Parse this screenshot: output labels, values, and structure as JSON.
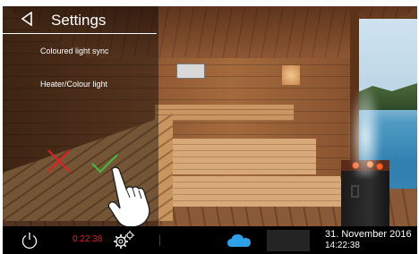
{
  "header": {
    "title": "Settings"
  },
  "menu": {
    "items": [
      {
        "label": "Coloured light sync"
      },
      {
        "label": "Heater/Colour light"
      }
    ]
  },
  "actions": {
    "cancel_icon": "x-icon",
    "confirm_icon": "check-icon"
  },
  "status_bar": {
    "timer": "0:22:38",
    "date": "31. November 2016",
    "time": "14:22:38",
    "icons": [
      "power-icon",
      "gear-icon",
      "cloud-icon"
    ]
  },
  "colors": {
    "accent_red": "#e02020",
    "accent_green": "#3fbf3f",
    "cloud_blue": "#2ea0e6",
    "bar_background": "#000000"
  }
}
